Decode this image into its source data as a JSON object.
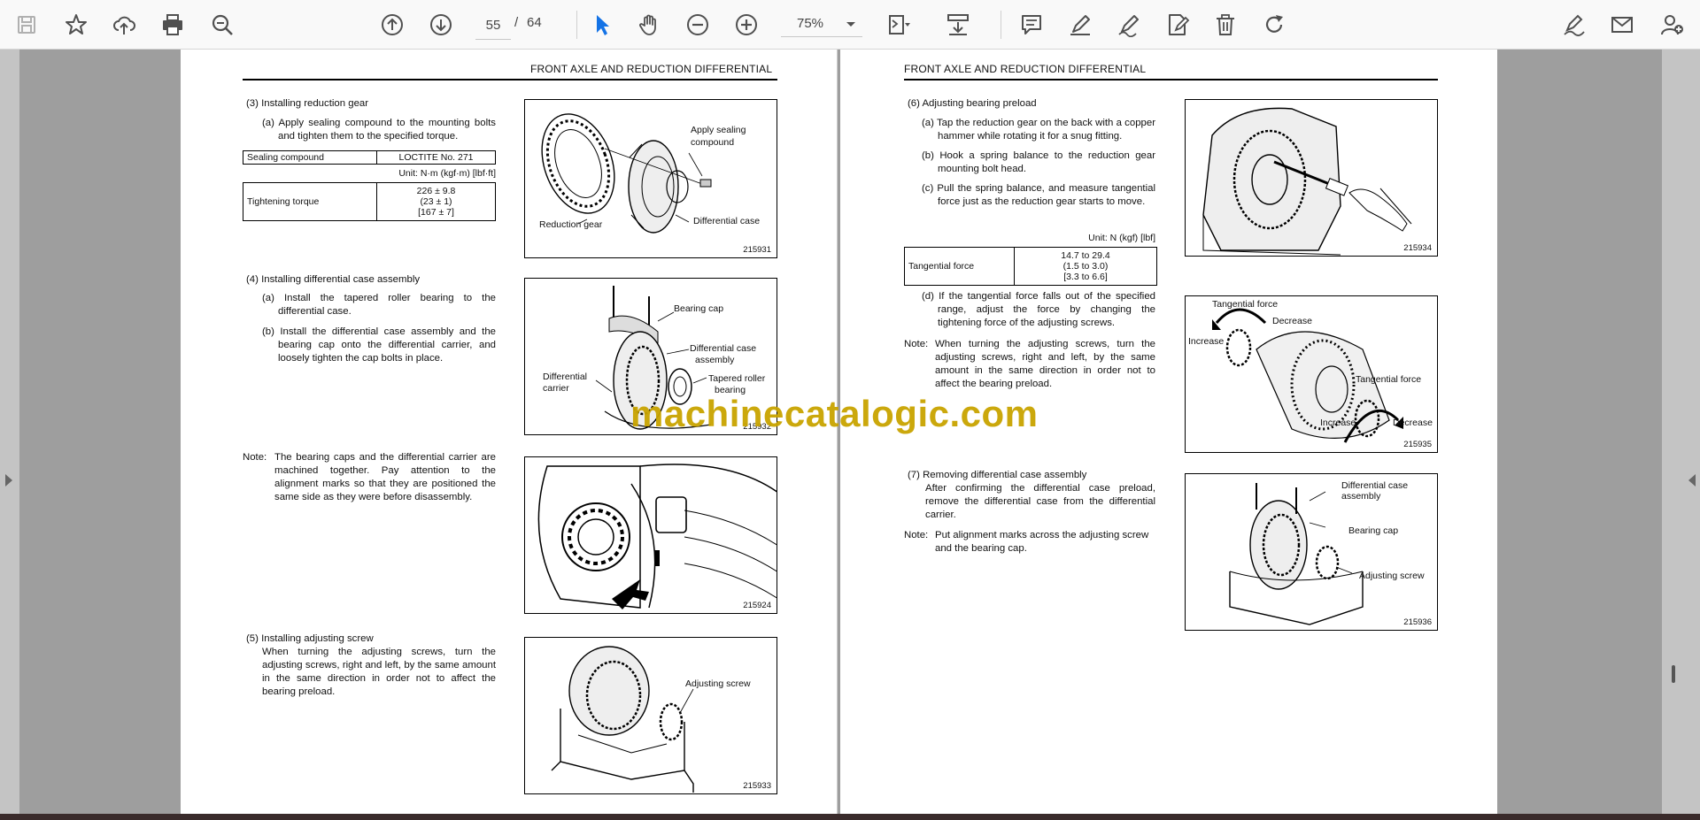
{
  "toolbar": {
    "page_current": "55",
    "page_separator": "/",
    "page_total": "64",
    "zoom": "75%",
    "icons": [
      "save-icon",
      "bookmark-star-icon",
      "upload-cloud-icon",
      "print-icon",
      "zoom-search-icon",
      "page-up-icon",
      "page-down-icon",
      "select-cursor-icon",
      "hand-tool-icon",
      "zoom-out-icon",
      "zoom-in-icon",
      "fit-page-icon",
      "scroll-mode-icon",
      "comment-icon",
      "highlight-pen-icon",
      "sign-icon",
      "edit-document-icon",
      "delete-icon",
      "rotate-icon",
      "fill-sign-icon",
      "email-icon",
      "share-user-icon"
    ],
    "accent_color": "#1473e6",
    "icon_color": "#505050"
  },
  "left_page": {
    "header": "FRONT AXLE AND REDUCTION DIFFERENTIAL",
    "s3": {
      "title": "(3)  Installing reduction gear",
      "a": "(a) Apply sealing compound to the mounting bolts and tighten them to the specified torque.",
      "table1": {
        "label": "Sealing compound",
        "value": "LOCTITE No. 271"
      },
      "unit": "Unit: N·m (kgf·m) [lbf·ft]",
      "table2": {
        "label": "Tightening torque",
        "v1": "226 ± 9.8",
        "v2": "(23 ± 1)",
        "v3": "[167 ± 7]"
      },
      "fig": {
        "l1": "Apply sealing",
        "l2": "compound",
        "l3": "Reduction gear",
        "l4": "Differential case",
        "num": "215931"
      }
    },
    "s4": {
      "title": "(4)  Installing differential case assembly",
      "a": "(a) Install the tapered roller bearing to the differential case.",
      "b": "(b) Install the differential case assembly and the bearing cap onto the differential carrier, and loosely tighten the cap bolts in place.",
      "fig": {
        "l1": "Bearing cap",
        "l2": "Differential case",
        "l3": "assembly",
        "l4": "Differential",
        "l5": "carrier",
        "l6": "Tapered roller",
        "l7": "bearing",
        "num": "215932"
      }
    },
    "note": {
      "label": "Note:",
      "text": "The bearing caps and the differential carrier are machined together. Pay attention to the alignment marks so that they are positioned the same side as they were before disassembly.",
      "fig": {
        "num": "215924"
      }
    },
    "s5": {
      "title": "(5)  Installing adjusting screw",
      "text": "When turning the adjusting screws, turn the adjusting screws, right and left, by the same amount in the same direction in order not to affect the bearing preload.",
      "fig": {
        "l1": "Adjusting screw",
        "num": "215933"
      }
    }
  },
  "right_page": {
    "header": "FRONT AXLE AND REDUCTION DIFFERENTIAL",
    "s6": {
      "title": "(6)  Adjusting bearing preload",
      "a": "(a) Tap the reduction gear on the back with a copper hammer while rotating it for a snug fitting.",
      "b": "(b) Hook a spring balance to the reduction gear mounting bolt head.",
      "c": "(c) Pull the spring balance, and measure tangential force just as the reduction gear starts to move.",
      "unit": "Unit: N (kgf) [lbf]",
      "table": {
        "label": "Tangential force",
        "v1": "14.7 to 29.4",
        "v2": "(1.5 to 3.0)",
        "v3": "[3.3 to 6.6]"
      },
      "d": "(d) If the tangential force falls out of the specified range, adjust the force by changing the tightening force of the adjusting screws.",
      "note_label": "Note:",
      "note": "When turning the adjusting screws, turn the adjusting screws, right and left, by the same amount in the same direction in order not to affect the bearing preload.",
      "fig1": {
        "num": "215934"
      },
      "fig2": {
        "l1": "Tangential force",
        "l2": "Decrease",
        "l3": "Increase",
        "l4": "Tangential force",
        "l5": "Increase",
        "l6": "Decrease",
        "num": "215935"
      }
    },
    "s7": {
      "title": "(7)  Removing differential case assembly",
      "text": "After confirming the differential case preload, remove the differential case from the differential carrier.",
      "note_label": "Note:",
      "note": "Put alignment marks across the adjusting screw and the bearing cap.",
      "fig": {
        "l1": "Differential case",
        "l2": "assembly",
        "l3": "Bearing cap",
        "l4": "Adjusting screw",
        "num": "215936"
      }
    }
  },
  "watermark": "machinecatalogic.com"
}
